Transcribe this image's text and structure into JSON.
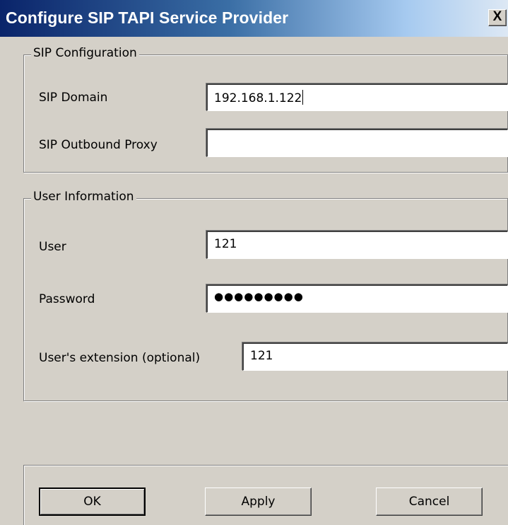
{
  "window": {
    "title": "Configure SIP TAPI Service Provider",
    "close_label": "X"
  },
  "sip_configuration": {
    "legend": "SIP Configuration",
    "domain_label": "SIP Domain",
    "domain_value": "192.168.1.122",
    "proxy_label": "SIP Outbound Proxy",
    "proxy_value": ""
  },
  "user_information": {
    "legend": "User Information",
    "user_label": "User",
    "user_value": "121",
    "password_label": "Password",
    "password_value": "●●●●●●●●●",
    "extension_label": "User's extension (optional)",
    "extension_value": "121"
  },
  "buttons": {
    "ok": "OK",
    "apply": "Apply",
    "cancel": "Cancel"
  }
}
